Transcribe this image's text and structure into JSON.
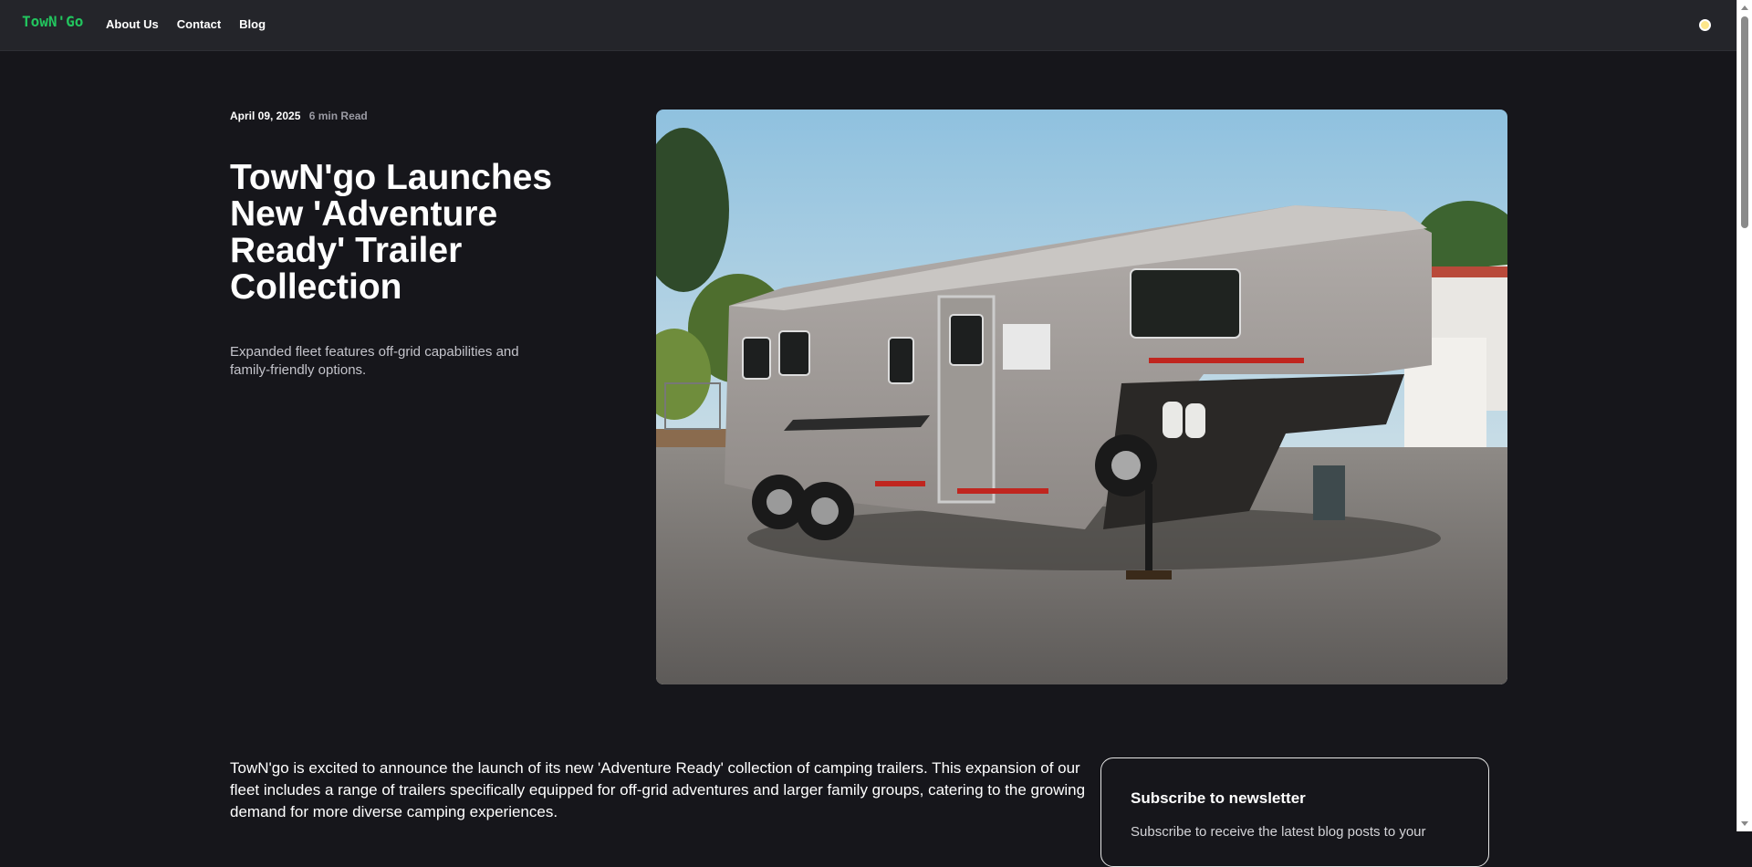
{
  "nav": {
    "logo": "TowN'Go",
    "links": [
      "About Us",
      "Contact",
      "Blog"
    ]
  },
  "article": {
    "date": "April 09, 2025",
    "read_time": "6 min Read",
    "title": "TowN'go Launches New 'Adventure Ready' Trailer Collection",
    "subtitle": "Expanded fleet features off-grid capabilities and family-friendly options.",
    "body": "TowN'go is excited to announce the launch of its new 'Adventure Ready' collection of camping trailers. This expansion of our fleet includes a range of trailers specifically equipped for off-grid adventures and larger family groups, catering to the growing demand for more diverse camping experiences."
  },
  "newsletter": {
    "heading": "Subscribe to newsletter",
    "text": "Subscribe to receive the latest blog posts to your"
  },
  "icons": {
    "theme": "theme-toggle-icon",
    "hero": "trailer-photo"
  },
  "colors": {
    "background": "#16161b",
    "topbar": "#24252a",
    "brand": "#22c55e"
  }
}
